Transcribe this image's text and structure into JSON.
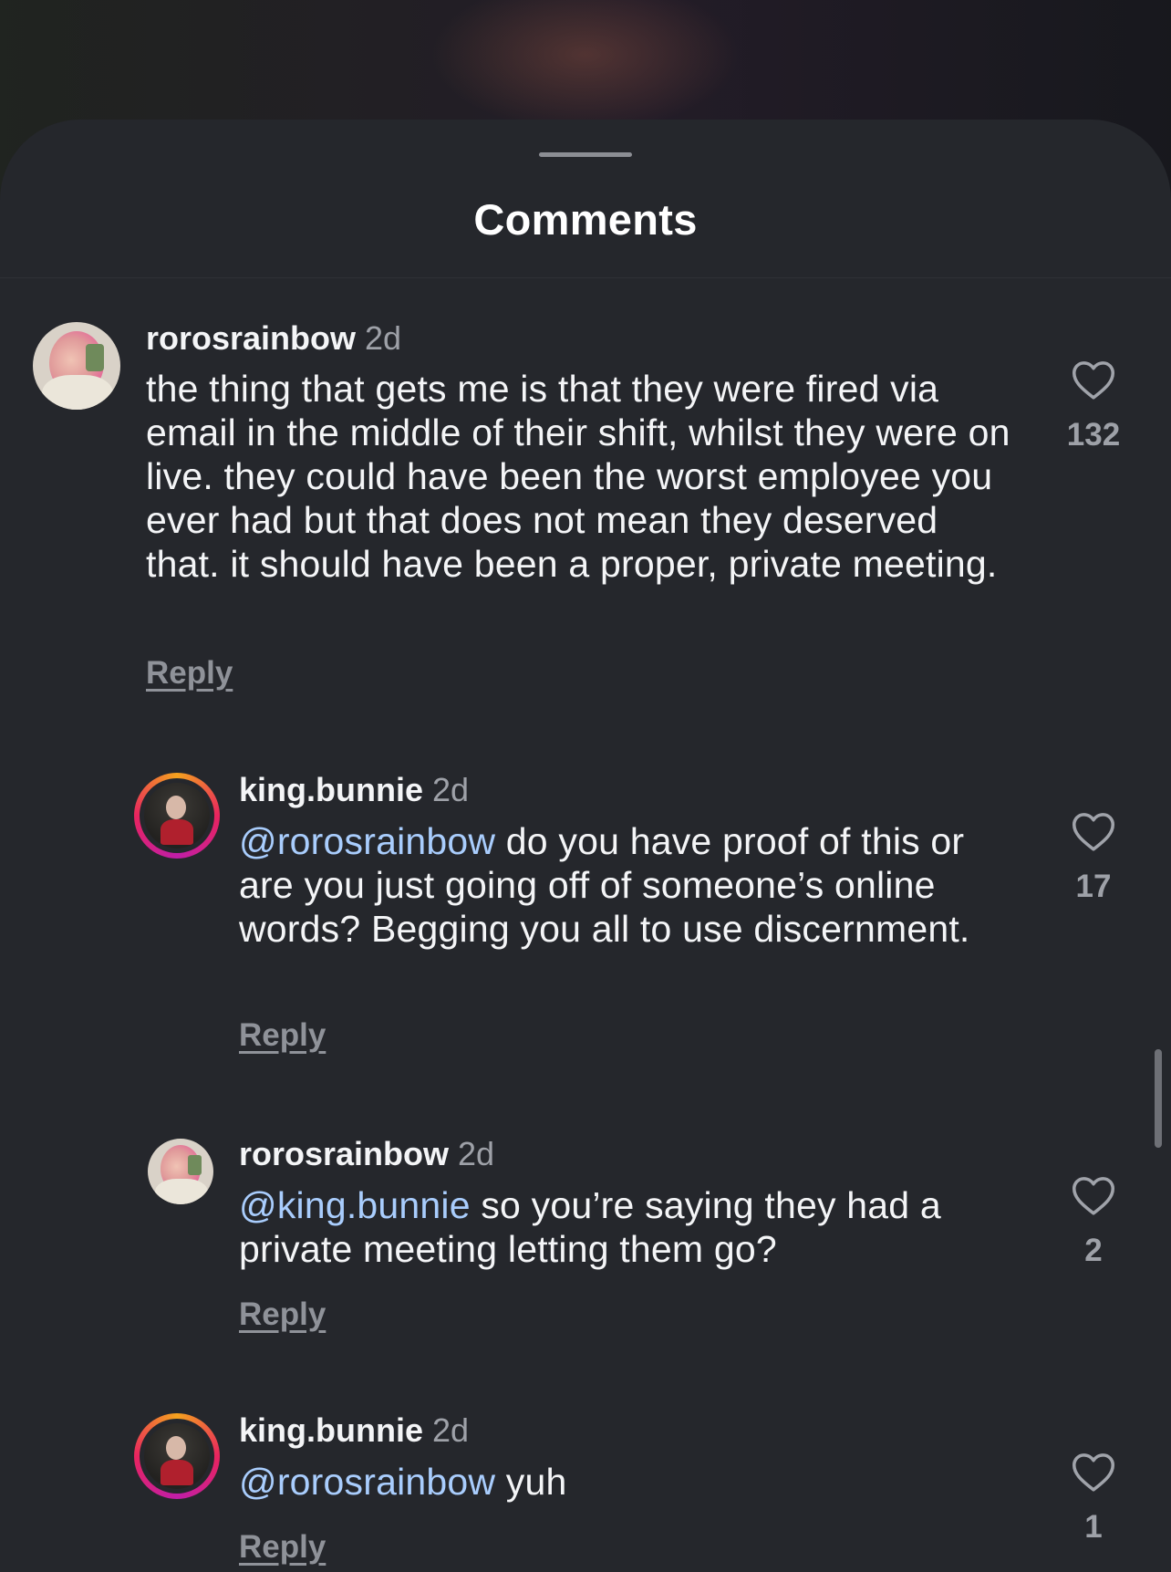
{
  "sheet": {
    "title": "Comments"
  },
  "comments": [
    {
      "username": "rorosrainbow",
      "time": "2d",
      "mention": "",
      "text": "the thing that gets me is that they were fired via email in the middle of their shift, whilst they were on live. they could have been the worst employee you ever had but that does not mean they deserved that. it should have been a proper, private meeting.",
      "reply_label": "Reply",
      "likes": "132"
    },
    {
      "username": "king.bunnie",
      "time": "2d",
      "mention": "@rorosrainbow",
      "text": " do you have proof of this or are you just going off of someone’s online words? Begging you all to use discernment.",
      "reply_label": "Reply",
      "likes": "17"
    },
    {
      "username": "rorosrainbow",
      "time": "2d",
      "mention": "@king.bunnie",
      "text": " so you’re saying they had a private meeting letting them go?",
      "reply_label": "Reply",
      "likes": "2"
    },
    {
      "username": "king.bunnie",
      "time": "2d",
      "mention": "@rorosrainbow",
      "text": " yuh",
      "reply_label": "Reply",
      "likes": "1"
    }
  ],
  "icons": {
    "like": "heart-outline-icon"
  },
  "colors": {
    "sheet_background": "#25272c",
    "mention": "#a9cdfd",
    "secondary_text": "#9ea1a8",
    "story_ring": [
      "#f4a21e",
      "#e8245f",
      "#c01ea8"
    ]
  }
}
